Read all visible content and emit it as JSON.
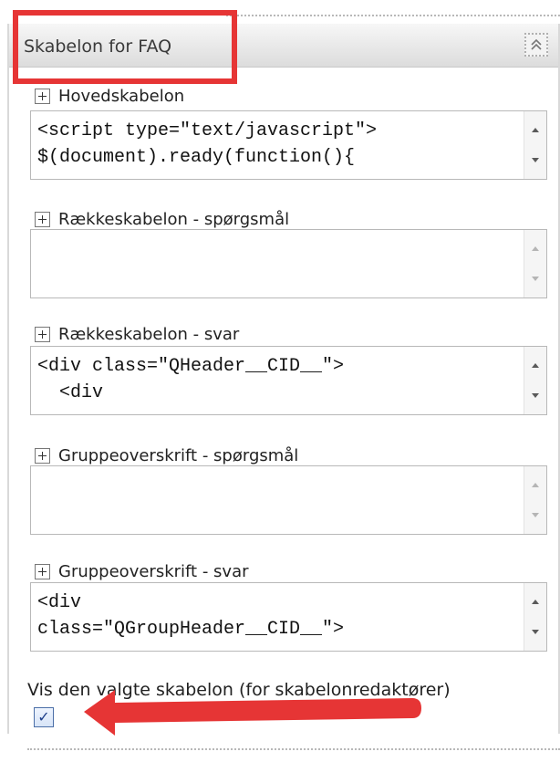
{
  "panel": {
    "title": "Skabelon for FAQ",
    "collapse_icon": "double-chevron-up-icon",
    "highlight_color": "#e63535"
  },
  "sections": [
    {
      "label": "Hovedskabelon",
      "code_lines": [
        "<script type=\"text/javascript\">",
        "$(document).ready(function(){"
      ]
    },
    {
      "label": "Rækkeskabelon - spørgsmål",
      "code_lines": []
    },
    {
      "label": "Rækkeskabelon - svar",
      "code_lines": [
        "<div class=\"QHeader__CID__\">",
        "  <div"
      ]
    },
    {
      "label": "Gruppeoverskrift - spørgsmål",
      "code_lines": []
    },
    {
      "label": "Gruppeoverskrift - svar",
      "code_lines": [
        "<div",
        "class=\"QGroupHeader__CID__\">"
      ]
    }
  ],
  "checkbox": {
    "label": "Vis den valgte skabelon (for skabelonredaktører)",
    "checked": true
  },
  "annotation": {
    "arrow_color": "#e63535"
  }
}
